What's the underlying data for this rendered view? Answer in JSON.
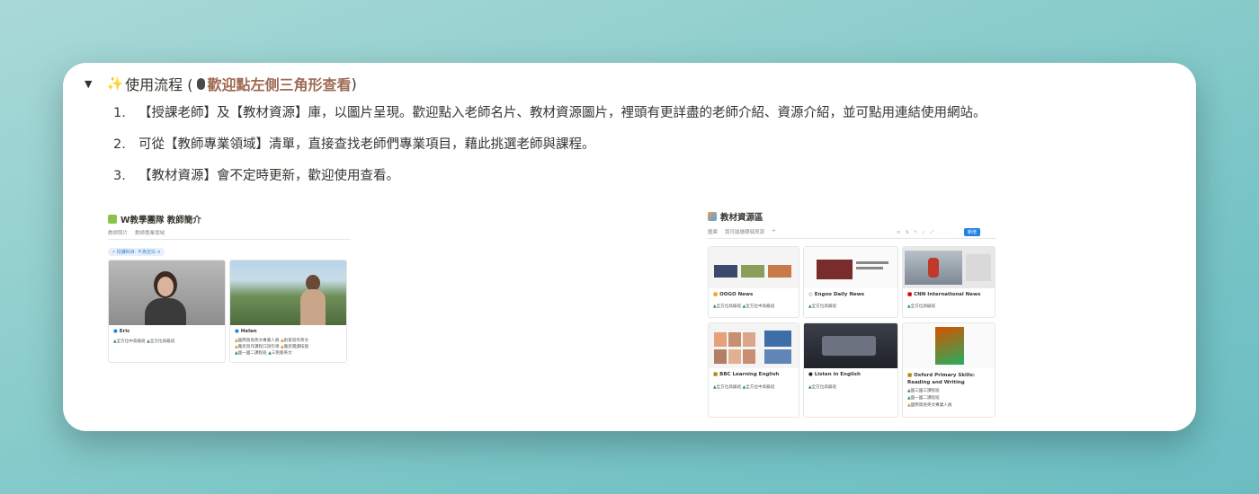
{
  "toggle": {
    "arrow": "▼",
    "sparkle": "✨",
    "prefix": "使用流程 (",
    "hint": "歡迎點左側三角形查看",
    "suffix": ")"
  },
  "steps": [
    {
      "num": "1.",
      "text": "【授課老師】及【教材資源】庫，以圖片呈現。歡迎點入老師名片、教材資源圖片，裡頭有更詳盡的老師介紹、資源介紹，並可點用連結使用網站。"
    },
    {
      "num": "2.",
      "text": "可從【教師專業領域】清單，直接查找老師們專業項目，藉此挑選老師與課程。"
    },
    {
      "num": "3.",
      "text": "【教材資源】會不定時更新，歡迎使用查看。"
    }
  ],
  "teachers": {
    "title": "W教學團隊 教師簡介",
    "tabs": [
      "教師照片",
      "教師專業領域"
    ],
    "filter": "↗ 授課科目: 不為空白 ×",
    "cards": [
      {
        "name": "Eric",
        "tags": [
          "全方位中高級班",
          "全方位高級班"
        ]
      },
      {
        "name": "Helen",
        "tags": [
          "國際貿易英文專業人員",
          "創意寫作英文",
          "雅思寫作課程口說引導",
          "雅思閱讀技能",
          "國一國二課程班",
          "三民版英文"
        ]
      }
    ]
  },
  "resources": {
    "title": "教材資源區",
    "tabs": [
      "圖庫",
      "我可能讀哪個資源",
      "+"
    ],
    "new_label": "新增",
    "tools": "≡ ⇅ ϟ ⌕ ⤢ ···",
    "cards": [
      {
        "name": "OOGO News",
        "tags": [
          "全方位高級班",
          "全方位中高級班"
        ]
      },
      {
        "name": "Engoo Daily News",
        "tags": [
          "全方位高級班"
        ]
      },
      {
        "name": "CNN International News",
        "tags": [
          "全方位高級班"
        ]
      },
      {
        "name": "BBC Learning English",
        "tags": [
          "全方位高級班",
          "全方位中高級班"
        ]
      },
      {
        "name": "Listen in English",
        "tags": [
          "全方位高級班"
        ]
      },
      {
        "name": "Oxford Primary Skills: Reading and Writing",
        "tags": [
          "國三國三課程班",
          "國一國二課程班",
          "國際貿易英文專業人員"
        ]
      }
    ]
  }
}
